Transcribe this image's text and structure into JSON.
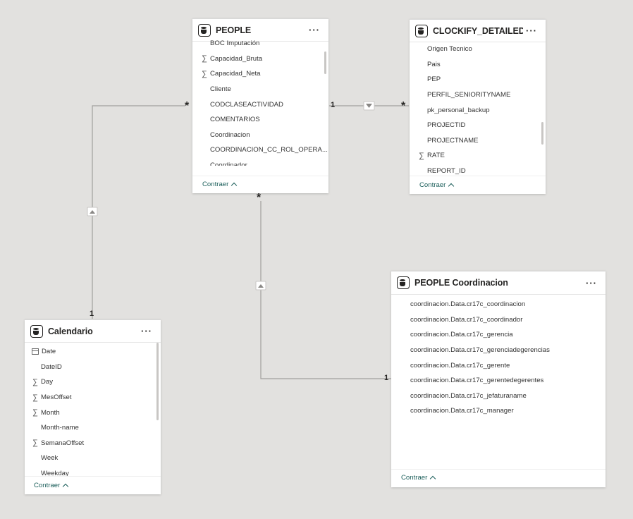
{
  "tables": {
    "people": {
      "title": "PEOPLE",
      "fields": [
        {
          "name": "BOC Imputación",
          "icon": "none"
        },
        {
          "name": "Capacidad_Bruta",
          "icon": "sigma"
        },
        {
          "name": "Capacidad_Neta",
          "icon": "sigma"
        },
        {
          "name": "Cliente",
          "icon": "none"
        },
        {
          "name": "CODCLASEACTIVIDAD",
          "icon": "none"
        },
        {
          "name": "COMENTARIOS",
          "icon": "none"
        },
        {
          "name": "Coordinacion",
          "icon": "none"
        },
        {
          "name": "COORDINACION_CC_ROL_OPERA...",
          "icon": "none"
        },
        {
          "name": "Coordinador",
          "icon": "none"
        }
      ],
      "footer": "Contraer"
    },
    "clockify": {
      "title": "CLOCKIFY_DETAILED_RE...",
      "fields": [
        {
          "name": "Origen Tecnico",
          "icon": "none"
        },
        {
          "name": "Pais",
          "icon": "none"
        },
        {
          "name": "PEP",
          "icon": "none"
        },
        {
          "name": "PERFIL_SENIORITYNAME",
          "icon": "none"
        },
        {
          "name": "pk_personal_backup",
          "icon": "none"
        },
        {
          "name": "PROJECTID",
          "icon": "none"
        },
        {
          "name": "PROJECTNAME",
          "icon": "none"
        },
        {
          "name": "RATE",
          "icon": "sigma"
        },
        {
          "name": "REPORT_ID",
          "icon": "none"
        }
      ],
      "footer": "Contraer"
    },
    "coordinacion": {
      "title": "PEOPLE Coordinacion",
      "fields": [
        {
          "name": "coordinacion.Data.cr17c_coordinacion",
          "icon": "none"
        },
        {
          "name": "coordinacion.Data.cr17c_coordinador",
          "icon": "none"
        },
        {
          "name": "coordinacion.Data.cr17c_gerencia",
          "icon": "none"
        },
        {
          "name": "coordinacion.Data.cr17c_gerenciadegerencias",
          "icon": "none"
        },
        {
          "name": "coordinacion.Data.cr17c_gerente",
          "icon": "none"
        },
        {
          "name": "coordinacion.Data.cr17c_gerentedegerentes",
          "icon": "none"
        },
        {
          "name": "coordinacion.Data.cr17c_jefaturaname",
          "icon": "none"
        },
        {
          "name": "coordinacion.Data.cr17c_manager",
          "icon": "none"
        }
      ],
      "footer": "Contraer"
    },
    "calendario": {
      "title": "Calendario",
      "fields": [
        {
          "name": "Date",
          "icon": "calendar"
        },
        {
          "name": "DateID",
          "icon": "none"
        },
        {
          "name": "Day",
          "icon": "sigma"
        },
        {
          "name": "MesOffset",
          "icon": "sigma"
        },
        {
          "name": "Month",
          "icon": "sigma"
        },
        {
          "name": "Month-name",
          "icon": "none"
        },
        {
          "name": "SemanaOffset",
          "icon": "sigma"
        },
        {
          "name": "Week",
          "icon": "none"
        },
        {
          "name": "Weekday",
          "icon": "none"
        }
      ],
      "footer": "Contraer"
    }
  },
  "relationships": {
    "people_calendario": {
      "from_mark": "*",
      "to_mark": "1"
    },
    "people_clockify": {
      "from_mark": "1",
      "to_mark": "*"
    },
    "people_coordinacion": {
      "from_mark": "*",
      "to_mark": "1"
    }
  },
  "more_label": "···",
  "colors": {
    "canvas": "#e2e1df",
    "line": "#a19f9d",
    "link": "#1b5e5a"
  }
}
